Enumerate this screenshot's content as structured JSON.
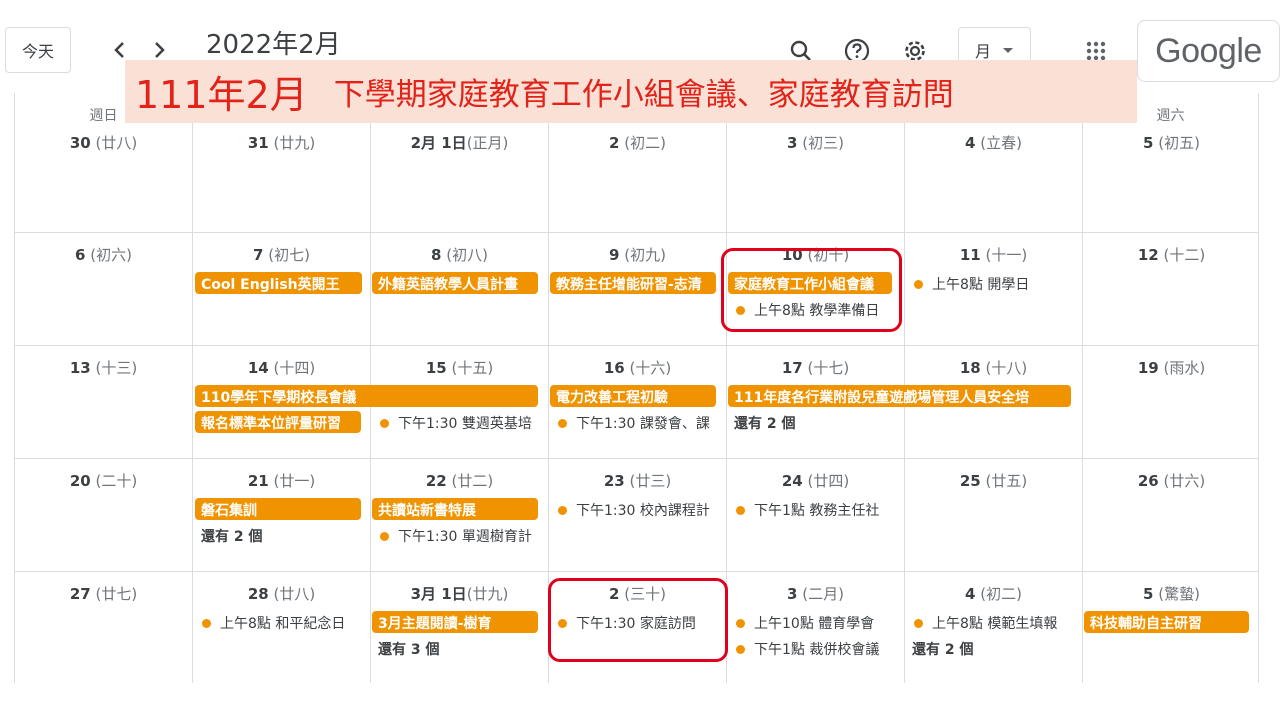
{
  "header": {
    "today_label": "今天",
    "month_title": "2022年2月",
    "view_label": "月",
    "logo_text": "Google",
    "icons": [
      "chevron-left-icon",
      "chevron-right-icon",
      "search-icon",
      "help-icon",
      "gear-icon",
      "apps-grid-icon"
    ]
  },
  "banner": {
    "title": "111年2月",
    "subtitle": "下學期家庭教育工作小組會議、家庭教育訪問"
  },
  "weekdays": {
    "sun": "週日",
    "sat": "週六"
  },
  "weeks": [
    {
      "days": [
        {
          "num": "30",
          "lunar": "(廿八)"
        },
        {
          "num": "31",
          "lunar": "(廿九)"
        },
        {
          "num": "2月 1日",
          "lunar": "(正月)"
        },
        {
          "num": "2",
          "lunar": "(初二)"
        },
        {
          "num": "3",
          "lunar": "(初三)"
        },
        {
          "num": "4",
          "lunar": "(立春)"
        },
        {
          "num": "5",
          "lunar": "(初五)"
        }
      ]
    },
    {
      "days": [
        {
          "num": "6",
          "lunar": "(初六)"
        },
        {
          "num": "7",
          "lunar": "(初七)"
        },
        {
          "num": "8",
          "lunar": "(初八)"
        },
        {
          "num": "9",
          "lunar": "(初九)"
        },
        {
          "num": "10",
          "lunar": "(初十)"
        },
        {
          "num": "11",
          "lunar": "(十一)"
        },
        {
          "num": "12",
          "lunar": "(十二)"
        }
      ],
      "events": {
        "e1": "Cool English英閱王",
        "e2": "外籍英語教學人員計畫",
        "e3": "教務主任增能研習-志清",
        "e4": "家庭教育工作小組會議",
        "e5": "上午8點 教學準備日",
        "e6": "上午8點 開學日"
      }
    },
    {
      "days": [
        {
          "num": "13",
          "lunar": "(十三)"
        },
        {
          "num": "14",
          "lunar": "(十四)"
        },
        {
          "num": "15",
          "lunar": "(十五)"
        },
        {
          "num": "16",
          "lunar": "(十六)"
        },
        {
          "num": "17",
          "lunar": "(十七)"
        },
        {
          "num": "18",
          "lunar": "(十八)"
        },
        {
          "num": "19",
          "lunar": "(雨水)"
        }
      ],
      "events": {
        "e1": "110學年下學期校長會議",
        "e2": "報名標準本位評量研習",
        "e3": "下午1:30 雙週英基培",
        "e4": "電力改善工程初驗",
        "e5": "下午1:30 課發會、課",
        "e6": "111年度各行業附設兒童遊戲場管理人員安全培",
        "more": "還有 2 個"
      }
    },
    {
      "days": [
        {
          "num": "20",
          "lunar": "(二十)"
        },
        {
          "num": "21",
          "lunar": "(廿一)"
        },
        {
          "num": "22",
          "lunar": "(廿二)"
        },
        {
          "num": "23",
          "lunar": "(廿三)"
        },
        {
          "num": "24",
          "lunar": "(廿四)"
        },
        {
          "num": "25",
          "lunar": "(廿五)"
        },
        {
          "num": "26",
          "lunar": "(廿六)"
        }
      ],
      "events": {
        "e1": "磐石集訓",
        "more1": "還有 2 個",
        "e2": "共讀站新書特展",
        "e3": "下午1:30 單週樹育計",
        "e4": "下午1:30 校內課程計",
        "e5": "下午1點 教務主任社"
      }
    },
    {
      "days": [
        {
          "num": "27",
          "lunar": "(廿七)"
        },
        {
          "num": "28",
          "lunar": "(廿八)"
        },
        {
          "num": "3月 1日",
          "lunar": "(廿九)"
        },
        {
          "num": "2",
          "lunar": "(三十)"
        },
        {
          "num": "3",
          "lunar": "(二月)"
        },
        {
          "num": "4",
          "lunar": "(初二)"
        },
        {
          "num": "5",
          "lunar": "(驚蟄)"
        }
      ],
      "events": {
        "e1": "上午8點 和平紀念日",
        "e2": "3月主題閱讀-樹育",
        "more2": "還有 3 個",
        "e3": "下午1:30 家庭訪問",
        "e4": "上午10點 體育學會",
        "e5": "下午1點 裁併校會議",
        "e6": "上午8點 模範生填報",
        "more3": "還有 2 個",
        "e7": "科技輔助自主研習"
      }
    }
  ],
  "colors": {
    "event": "#f09300",
    "highlight": "#e0001b",
    "banner_bg": "#fbe0d6",
    "banner_text": "#e2231a"
  }
}
